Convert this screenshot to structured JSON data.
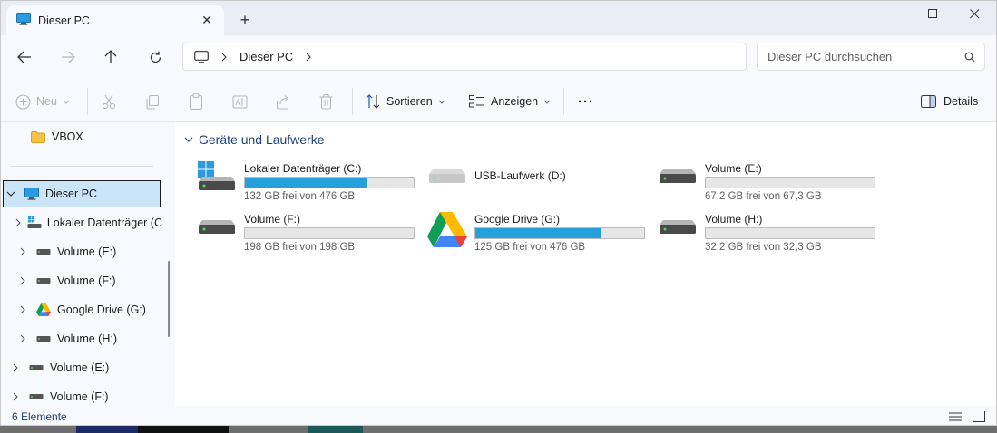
{
  "window": {
    "tab_title": "Dieser PC",
    "new_tab_symbol": "+",
    "close_tab_symbol": "✕"
  },
  "address": {
    "crumb": "Dieser PC",
    "search_placeholder": "Dieser PC durchsuchen"
  },
  "commands": {
    "new_label": "Neu",
    "sort_label": "Sortieren",
    "view_label": "Anzeigen",
    "more_label": "···",
    "details_label": "Details"
  },
  "nav": {
    "items": [
      {
        "label": "VBOX",
        "icon": "folder-icon"
      },
      {
        "label": "Dieser PC",
        "icon": "computer-icon"
      },
      {
        "label": "Lokaler Datenträger (C",
        "icon": "windows-drive-icon"
      },
      {
        "label": "Volume (E:)",
        "icon": "drive-icon"
      },
      {
        "label": "Volume (F:)",
        "icon": "drive-icon"
      },
      {
        "label": "Google Drive (G:)",
        "icon": "google-drive-icon"
      },
      {
        "label": "Volume (H:)",
        "icon": "drive-icon"
      },
      {
        "label": "Volume (E:)",
        "icon": "drive-icon"
      },
      {
        "label": "Volume (F:)",
        "icon": "drive-icon"
      }
    ]
  },
  "content": {
    "group_title": "Geräte und Laufwerke",
    "drives": [
      {
        "name": "Lokaler Datenträger (C:)",
        "free": "132 GB frei von 476 GB",
        "used_fraction": 0.72,
        "icon": "windows-drive-icon",
        "has_bar": true
      },
      {
        "name": "USB-Laufwerk (D:)",
        "free": "",
        "used_fraction": 0,
        "icon": "drive-icon",
        "has_bar": false
      },
      {
        "name": "Volume (E:)",
        "free": "67,2 GB frei von 67,3 GB",
        "used_fraction": 0.0,
        "icon": "drive-icon",
        "has_bar": true
      },
      {
        "name": "Volume (F:)",
        "free": "198 GB frei von 198 GB",
        "used_fraction": 0.0,
        "icon": "drive-icon",
        "has_bar": true
      },
      {
        "name": "Google Drive (G:)",
        "free": "125 GB frei von 476 GB",
        "used_fraction": 0.74,
        "icon": "google-drive-icon",
        "has_bar": true
      },
      {
        "name": "Volume (H:)",
        "free": "32,2 GB frei von 32,3 GB",
        "used_fraction": 0.0,
        "icon": "drive-icon",
        "has_bar": true
      }
    ]
  },
  "status": {
    "item_count": "6 Elemente"
  },
  "colors": {
    "accent": "#26a0da",
    "selection": "#cce4f7",
    "group_header": "#1a3f7a"
  }
}
